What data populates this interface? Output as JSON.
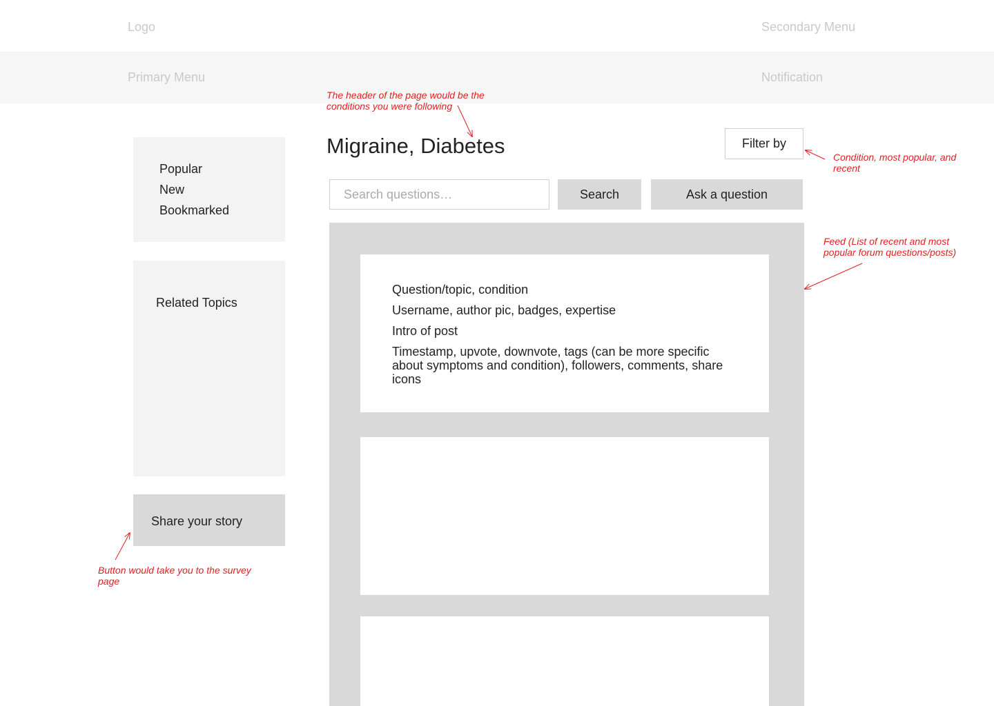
{
  "header": {
    "logo": "Logo",
    "secondary_menu": "Secondary Menu",
    "primary_menu": "Primary Menu",
    "notification": "Notification"
  },
  "sidebar": {
    "sort_links": [
      "Popular",
      "New",
      "Bookmarked"
    ],
    "related_topics_label": "Related Topics",
    "share_story_label": "Share your story"
  },
  "main": {
    "title": "Migraine, Diabetes",
    "filter_label": "Filter by",
    "search_placeholder": "Search questions…",
    "search_label": "Search",
    "ask_label": "Ask a question",
    "feed": {
      "first_card": {
        "topic": "Question/topic, condition",
        "author": "Username, author pic, badges, expertise",
        "intro": "Intro of post",
        "meta": "Timestamp, upvote, downvote, tags (can be more specific about symptoms and condition), followers, comments, share icons"
      }
    }
  },
  "annotations": {
    "header_note": "The header of the page would be the conditions you were following",
    "filter_note": "Condition, most popular, and recent",
    "feed_note": "Feed (List of recent and most popular forum questions/posts)",
    "button_note": "Button would take you to the survey page"
  },
  "colors": {
    "annotation": "#e02020",
    "panel_gray": "#d9d9d9",
    "sidebar_gray": "#f3f3f3",
    "menu_bar": "#f6f6f6"
  }
}
